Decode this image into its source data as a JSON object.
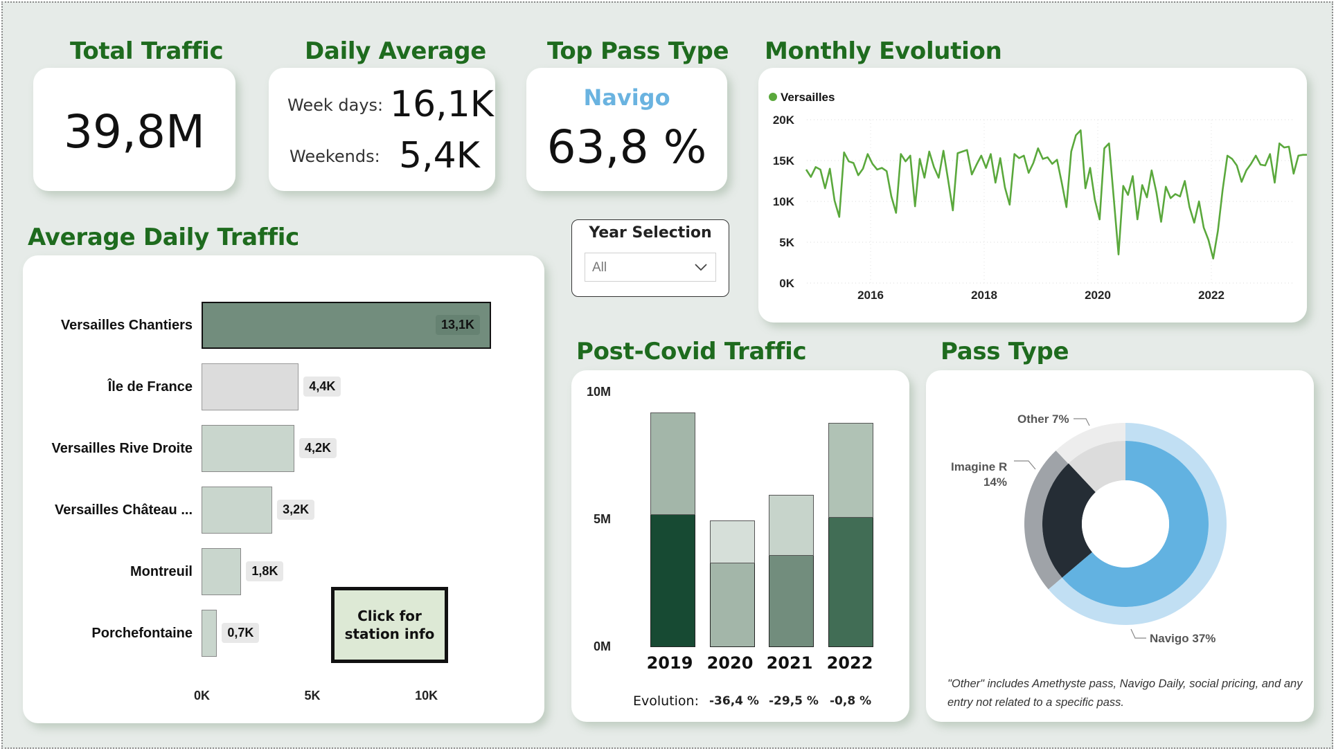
{
  "kpi": {
    "total_traffic": {
      "title": "Total Traffic",
      "value": "39,8M"
    },
    "daily_average": {
      "title": "Daily Average",
      "weekdays_label": "Week days:",
      "weekdays_value": "16,1K",
      "weekends_label": "Weekends:",
      "weekends_value": "5,4K"
    },
    "top_pass": {
      "title": "Top Pass Type",
      "name": "Navigo",
      "value": "63,8 %"
    }
  },
  "slicer": {
    "title": "Year Selection",
    "value": "All"
  },
  "colors": {
    "title_green": "#1e6b1e",
    "line_green": "#5aa83c",
    "navigo_blue": "#6ab3e0",
    "selected_bar": "#728d7d",
    "bar_gray": "#dcdcdc",
    "bar_light_green": "#c9d6cd"
  },
  "avg_daily": {
    "title": "Average Daily Traffic",
    "button_label": "Click for station info",
    "chart_data": {
      "type": "bar",
      "orientation": "horizontal",
      "categories": [
        "Versailles Chantiers",
        "Île de France",
        "Versailles Rive Droite",
        "Versailles Château ...",
        "Montreuil",
        "Porchefontaine"
      ],
      "values": [
        13.1,
        4.4,
        4.2,
        3.2,
        1.8,
        0.7
      ],
      "value_labels": [
        "13,1K",
        "4,4K",
        "4,2K",
        "3,2K",
        "1,8K",
        "0,7K"
      ],
      "unit": "K",
      "xlim": [
        0,
        13.1
      ],
      "xticks": [
        "0K",
        "5K",
        "10K"
      ],
      "xtick_values": [
        0,
        5,
        10
      ],
      "selected_index": 0
    }
  },
  "monthly": {
    "title": "Monthly Evolution",
    "chart_data": {
      "type": "line",
      "series": [
        {
          "name": "Versailles",
          "x_start": "2015-01",
          "frequency": "monthly",
          "values": [
            13.9,
            13.0,
            14.2,
            13.9,
            11.6,
            14.0,
            10.1,
            8.1,
            16.0,
            14.9,
            14.7,
            13.2,
            14.0,
            15.8,
            14.6,
            13.9,
            14.1,
            13.7,
            10.6,
            8.6,
            15.8,
            14.9,
            15.6,
            9.4,
            15.2,
            12.9,
            16.1,
            14.2,
            12.9,
            16.2,
            12.6,
            8.9,
            15.9,
            16.1,
            16.3,
            13.3,
            14.5,
            15.6,
            14.1,
            15.8,
            12.3,
            15.3,
            11.7,
            9.6,
            15.8,
            15.3,
            15.6,
            13.5,
            14.7,
            16.5,
            15.2,
            15.4,
            14.6,
            15.1,
            12.3,
            9.3,
            16.1,
            18.1,
            18.7,
            11.6,
            14.1,
            10.2,
            7.8,
            16.5,
            17.1,
            10.3,
            3.5,
            11.9,
            10.8,
            13.1,
            7.8,
            12.0,
            10.5,
            13.8,
            11.1,
            7.5,
            11.8,
            10.4,
            10.9,
            10.6,
            12.5,
            9.3,
            7.4,
            10.0,
            6.8,
            5.3,
            3.0,
            6.4,
            11.4,
            15.6,
            15.2,
            14.4,
            12.4,
            13.8,
            14.6,
            15.6,
            14.5,
            14.4,
            15.8,
            12.3,
            17.1,
            16.6,
            16.7,
            13.4,
            15.6,
            15.7,
            15.7,
            14.8,
            14.2,
            16.5
          ]
        }
      ],
      "y_ticks": [
        "0K",
        "5K",
        "10K",
        "15K",
        "20K"
      ],
      "ylim": [
        0,
        20
      ],
      "x_ticks": [
        "2016",
        "2018",
        "2020",
        "2022"
      ],
      "legend": "top-left"
    }
  },
  "post_covid": {
    "title": "Post-Covid Traffic",
    "chart_data": {
      "type": "bar",
      "stacked": true,
      "categories": [
        "2019",
        "2020",
        "2021",
        "2022"
      ],
      "series": [
        {
          "values": [
            5.2,
            3.3,
            3.6,
            5.1
          ]
        },
        {
          "values": [
            4.0,
            1.7,
            2.4,
            3.7
          ]
        }
      ],
      "ylim": [
        0,
        10
      ],
      "y_ticks": [
        "0M",
        "5M",
        "10M"
      ],
      "bottom_colors": [
        "#174a33",
        "#a3b6a9",
        "#728d7d",
        "#416d55"
      ],
      "top_colors": [
        "#a3b6a9",
        "#d6dfd9",
        "#c7d4cb",
        "#b0c2b5"
      ]
    },
    "evolution_label": "Evolution:",
    "evolution_values": [
      "-36,4 %",
      "-29,5 %",
      "-0,8 %"
    ]
  },
  "pass_type": {
    "title": "Pass Type",
    "chart_data": {
      "type": "pie",
      "style": "donut",
      "outer_ring": [
        {
          "label": "Navigo",
          "value": 37,
          "color": "#c1dff3"
        },
        {
          "label": "Imagine R",
          "value": 14,
          "color": "#9fa3a8"
        },
        {
          "label": "Other",
          "value": 7,
          "color": "#ededed"
        }
      ],
      "inner_ring": [
        {
          "value": 63.8,
          "color": "#62b2e1"
        },
        {
          "value": 24.2,
          "color": "#252d35"
        },
        {
          "value": 12.0,
          "color": "#dcdcdc"
        }
      ],
      "labels": {
        "other": "Other 7%",
        "imagine_r_1": "Imagine R",
        "imagine_r_2": "14%",
        "navigo": "Navigo 37%"
      }
    },
    "note": "\"Other\" includes Amethyste pass, Navigo Daily, social pricing, and any entry not related to a specific pass."
  }
}
